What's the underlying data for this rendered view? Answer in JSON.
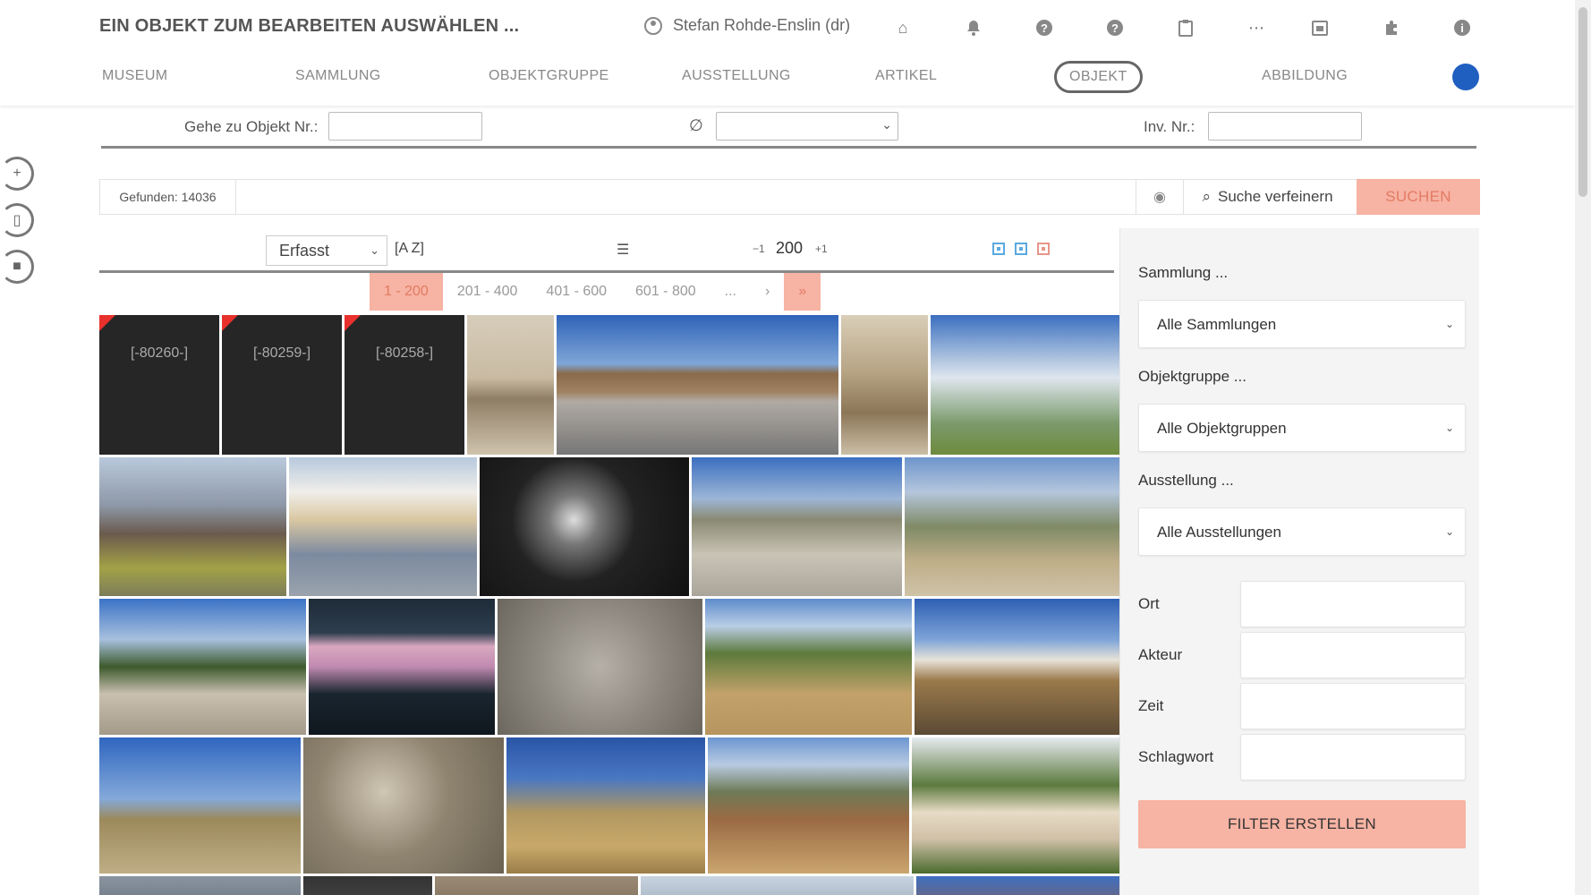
{
  "header": {
    "title": "EIN OBJEKT ZUM BEARBEITEN AUSWÄHLEN ...",
    "user": "Stefan Rohde-Enslin (dr)",
    "icons": [
      "home-icon",
      "bell-icon",
      "help-icon",
      "question-icon",
      "clipboard-icon",
      "more-icon",
      "calendar-icon",
      "puzzle-icon",
      "info-icon"
    ]
  },
  "nav": {
    "items": [
      {
        "label": "MUSEUM"
      },
      {
        "label": "SAMMLUNG"
      },
      {
        "label": "OBJEKTGRUPPE"
      },
      {
        "label": "AUSSTELLUNG"
      },
      {
        "label": "ARTIKEL"
      },
      {
        "label": "OBJEKT"
      },
      {
        "label": "ABBILDUNG"
      }
    ],
    "active": "OBJEKT"
  },
  "goto": {
    "label": "Gehe zu Objekt Nr.:",
    "empty_symbol": "∅",
    "inv_label": "Inv. Nr.:"
  },
  "search": {
    "found": "Gefunden: 14036",
    "refine_label": "Suche verfeinern",
    "search_label": "SUCHEN"
  },
  "list_toolbar": {
    "sort_value": "Erfasst",
    "az_label": "[A Z]",
    "minus": "−1",
    "page_size": "200",
    "plus": "+1"
  },
  "pagination": {
    "pages": [
      "1 - 200",
      "201 - 400",
      "401 - 600",
      "601 - 800",
      "...",
      "›"
    ],
    "next": "»"
  },
  "thumbnails": {
    "missing": [
      "[-80260-]",
      "[-80259-]",
      "[-80258-]"
    ]
  },
  "filter": {
    "collection_label": "Sammlung ...",
    "collection_value": "Alle Sammlungen",
    "group_label": "Objektgruppe ...",
    "group_value": "Alle Objektgruppen",
    "exhibition_label": "Ausstellung ...",
    "exhibition_value": "Alle Ausstellungen",
    "place_label": "Ort",
    "actor_label": "Akteur",
    "time_label": "Zeit",
    "tag_label": "Schlagwort",
    "create_label": "FILTER ERSTELLEN"
  },
  "colors": {
    "accent": "#f7b3a3",
    "accent_text": "#e27b64",
    "brand_circle": "#1f5fbf",
    "missing_bg": "#262626",
    "missing_flag": "#e8312c"
  }
}
